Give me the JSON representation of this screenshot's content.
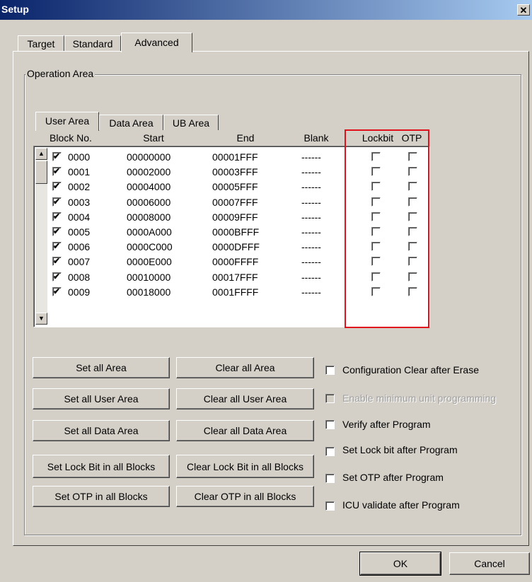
{
  "window": {
    "title": "Setup",
    "close_glyph": "✕"
  },
  "tabs": [
    "Target",
    "Standard",
    "Advanced"
  ],
  "group": {
    "label": "Operation Area"
  },
  "area_tabs": [
    "User Area",
    "Data Area",
    "UB Area"
  ],
  "columns": [
    "Block No.",
    "Start",
    "End",
    "Blank",
    "Lockbit",
    "OTP"
  ],
  "rows": [
    {
      "block": "0000",
      "start": "00000000",
      "end": "00001FFF",
      "blank": "------",
      "checked": true,
      "lockbit": false,
      "otp": false
    },
    {
      "block": "0001",
      "start": "00002000",
      "end": "00003FFF",
      "blank": "------",
      "checked": true,
      "lockbit": false,
      "otp": false
    },
    {
      "block": "0002",
      "start": "00004000",
      "end": "00005FFF",
      "blank": "------",
      "checked": true,
      "lockbit": false,
      "otp": false
    },
    {
      "block": "0003",
      "start": "00006000",
      "end": "00007FFF",
      "blank": "------",
      "checked": true,
      "lockbit": false,
      "otp": false
    },
    {
      "block": "0004",
      "start": "00008000",
      "end": "00009FFF",
      "blank": "------",
      "checked": true,
      "lockbit": false,
      "otp": false
    },
    {
      "block": "0005",
      "start": "0000A000",
      "end": "0000BFFF",
      "blank": "------",
      "checked": true,
      "lockbit": false,
      "otp": false
    },
    {
      "block": "0006",
      "start": "0000C000",
      "end": "0000DFFF",
      "blank": "------",
      "checked": true,
      "lockbit": false,
      "otp": false
    },
    {
      "block": "0007",
      "start": "0000E000",
      "end": "0000FFFF",
      "blank": "------",
      "checked": true,
      "lockbit": false,
      "otp": false
    },
    {
      "block": "0008",
      "start": "00010000",
      "end": "00017FFF",
      "blank": "------",
      "checked": true,
      "lockbit": false,
      "otp": false
    },
    {
      "block": "0009",
      "start": "00018000",
      "end": "0001FFFF",
      "blank": "------",
      "checked": true,
      "lockbit": false,
      "otp": false
    }
  ],
  "buttons": {
    "set_all_area": "Set all Area",
    "clear_all_area": "Clear all Area",
    "set_all_user_area": "Set all User Area",
    "clear_all_user_area": "Clear all User Area",
    "set_all_data_area": "Set all Data Area",
    "clear_all_data_area": "Clear all Data Area",
    "set_lock_bit": "Set Lock Bit in all Blocks",
    "clear_lock_bit": "Clear Lock Bit in all Blocks",
    "set_otp": "Set OTP in all Blocks",
    "clear_otp": "Clear OTP in all Blocks",
    "ok": "OK",
    "cancel": "Cancel"
  },
  "options": {
    "config_clear": "Configuration Clear after Erase",
    "min_unit": "Enable minimum unit programming",
    "verify": "Verify after Program",
    "set_lock": "Set Lock bit after Program",
    "set_otp": "Set OTP after Program",
    "icu": "ICU validate after Program"
  },
  "highlight_color": "#e0101c",
  "icons": {
    "check": "check-icon",
    "scroll_up": "up-arrow-icon",
    "scroll_down": "down-arrow-icon"
  }
}
